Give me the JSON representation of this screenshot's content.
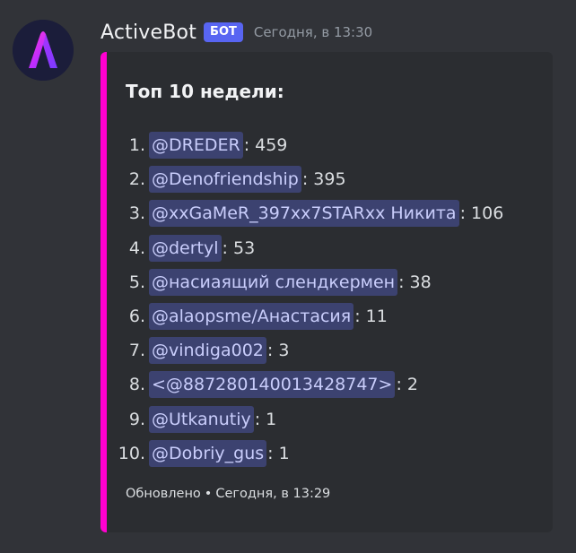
{
  "message": {
    "username": "ActiveBot",
    "bot_tag": "БОТ",
    "timestamp": "Сегодня, в 13:30"
  },
  "embed": {
    "accent_color": "#ff00d0",
    "title": "Топ 10 недели:",
    "items": [
      {
        "rank": "1.",
        "mention": "@DREDER",
        "score": ": 459"
      },
      {
        "rank": "2.",
        "mention": "@Denofriendship",
        "score": ": 395"
      },
      {
        "rank": "3.",
        "mention": "@xxGaMeR_397xx7STARxx Никита",
        "score": ": 106"
      },
      {
        "rank": "4.",
        "mention": "@dertyl",
        "score": ": 53"
      },
      {
        "rank": "5.",
        "mention": "@насиаящий слендкермен",
        "score": ": 38"
      },
      {
        "rank": "6.",
        "mention": "@alaopsme/Анастасия",
        "score": ": 11"
      },
      {
        "rank": "7.",
        "mention": "@vindiga002",
        "score": ": 3"
      },
      {
        "rank": "8.",
        "mention": "<@887280140013428747>",
        "score": ": 2"
      },
      {
        "rank": "9.",
        "mention": "@Utkanutiy",
        "score": ": 1"
      },
      {
        "rank": "10.",
        "mention": "@Dobriy_gus",
        "score": ": 1"
      }
    ],
    "footer": {
      "text": "Обновлено",
      "separator": "•",
      "time": "Сегодня, в 13:29"
    }
  },
  "icons": {
    "avatar": "activebot-logo-icon"
  }
}
